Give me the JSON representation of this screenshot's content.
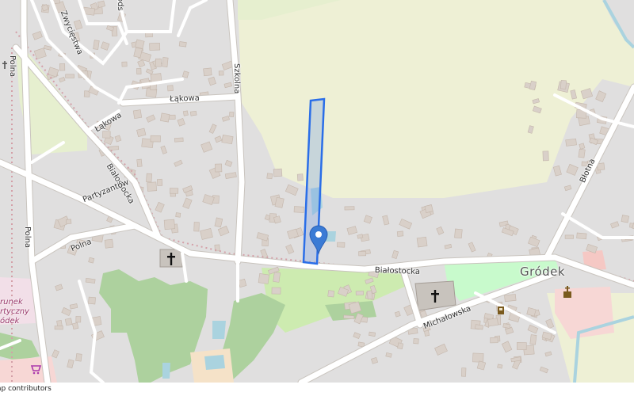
{
  "map": {
    "street_labels": {
      "zwyciestwa": "Zwycięstwa",
      "szkolna": "Szkolna",
      "lakowa_top": "Łąkowa",
      "lakowa_left": "Łąkowa",
      "bialostocka_left": "Białostocka",
      "bialostocka_main": "Białostocka",
      "partyzantow": "Partyzantów",
      "polna_left": "Polna",
      "polna_road": "Polna",
      "polna_lower": "Polna",
      "michalowska": "Michałowska",
      "blotna": "Błotna",
      "top_clip": "ods"
    },
    "place_label": "Gródek",
    "poi_text": [
      "runek",
      "rtyczny",
      "ódek"
    ],
    "icons": [
      "church-icon",
      "church-icon",
      "shop-icon",
      "orthodox-church-icon",
      "monument-icon",
      "map-marker-icon"
    ],
    "colors": {
      "background": "#e0dfdf",
      "farmland": "#eef0d5",
      "residential": "#e0dfdf",
      "building": "#d9d0c9",
      "building_outline": "#c4b6ab",
      "forest": "#add19e",
      "park": "#c8facc",
      "water": "#aad3df",
      "road": "#ffffff",
      "boundary": "#d4a0a8",
      "highlight_fill": "#7ea3e6",
      "highlight_stroke": "#2a6ee8",
      "marker": "#3a7bd5"
    }
  },
  "attribution": "ap contributors"
}
